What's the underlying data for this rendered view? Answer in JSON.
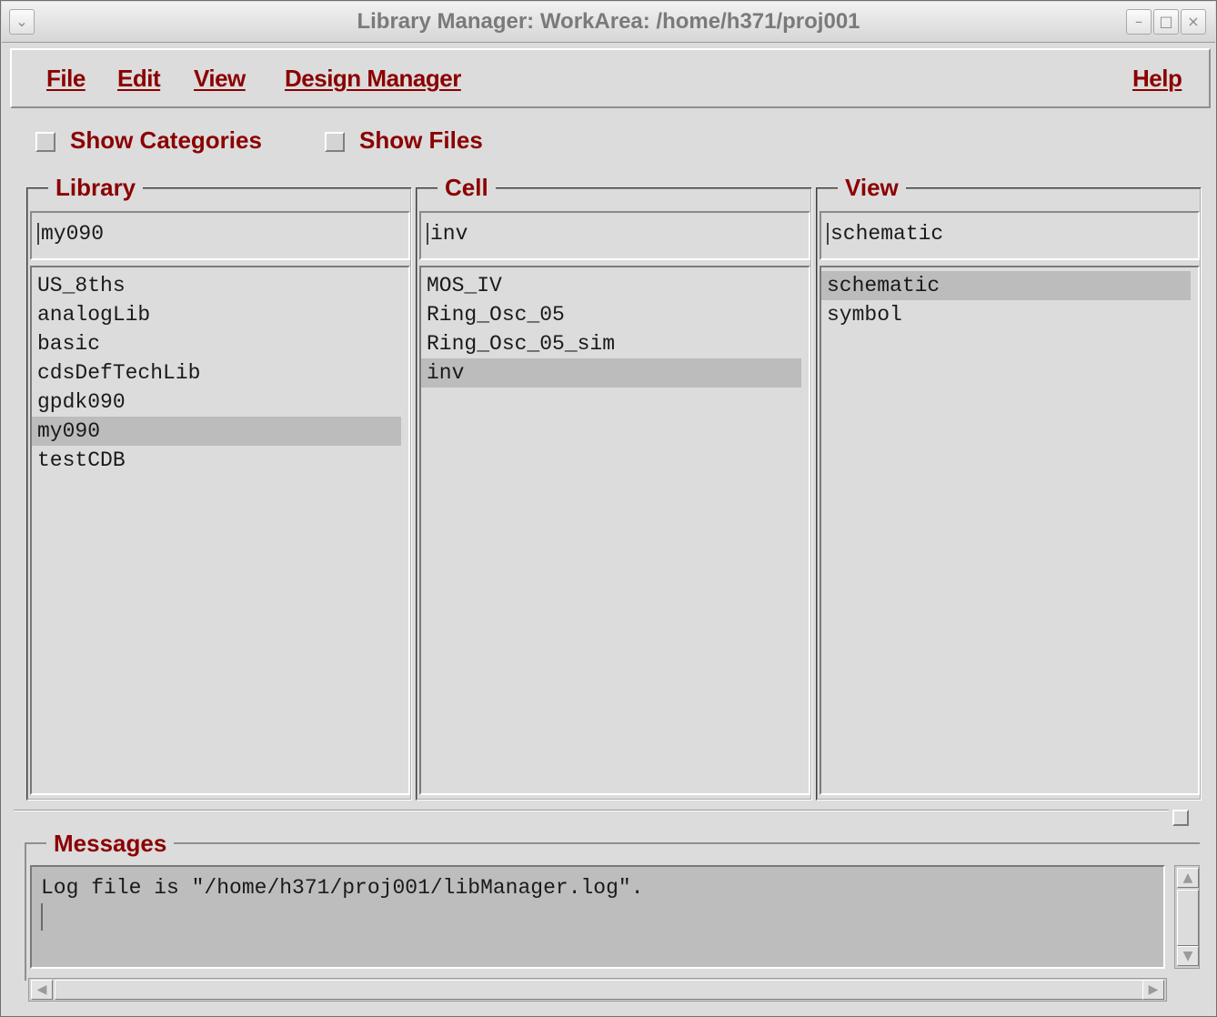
{
  "window": {
    "title": "Library Manager: WorkArea: /home/h371/proj001",
    "menu_icon": "chevron-down-icon",
    "buttons": {
      "minimize": "–",
      "maximize": "□",
      "close": "×"
    }
  },
  "menubar": {
    "file": "File",
    "edit": "Edit",
    "view": "View",
    "design_manager": "Design Manager",
    "help": "Help"
  },
  "options": {
    "show_categories": {
      "label": "Show Categories",
      "checked": false
    },
    "show_files": {
      "label": "Show Files",
      "checked": false
    }
  },
  "columns": {
    "library": {
      "label": "Library",
      "value": "my090",
      "items": [
        "US_8ths",
        "analogLib",
        "basic",
        "cdsDefTechLib",
        "gpdk090",
        "my090",
        "testCDB"
      ],
      "selected_index": 5
    },
    "cell": {
      "label": "Cell",
      "value": "inv",
      "items": [
        "MOS_IV",
        "Ring_Osc_05",
        "Ring_Osc_05_sim",
        "inv"
      ],
      "selected_index": 3
    },
    "view": {
      "label": "View",
      "value": "schematic",
      "items": [
        "schematic",
        "symbol"
      ],
      "selected_index": 0
    }
  },
  "messages": {
    "label": "Messages",
    "text": "Log file is \"/home/h371/proj001/libManager.log\"."
  },
  "colors": {
    "accent_text": "#8b0000",
    "background": "#dcdcdc",
    "selection": "#bcbcbc",
    "message_bg": "#bdbdbd"
  }
}
